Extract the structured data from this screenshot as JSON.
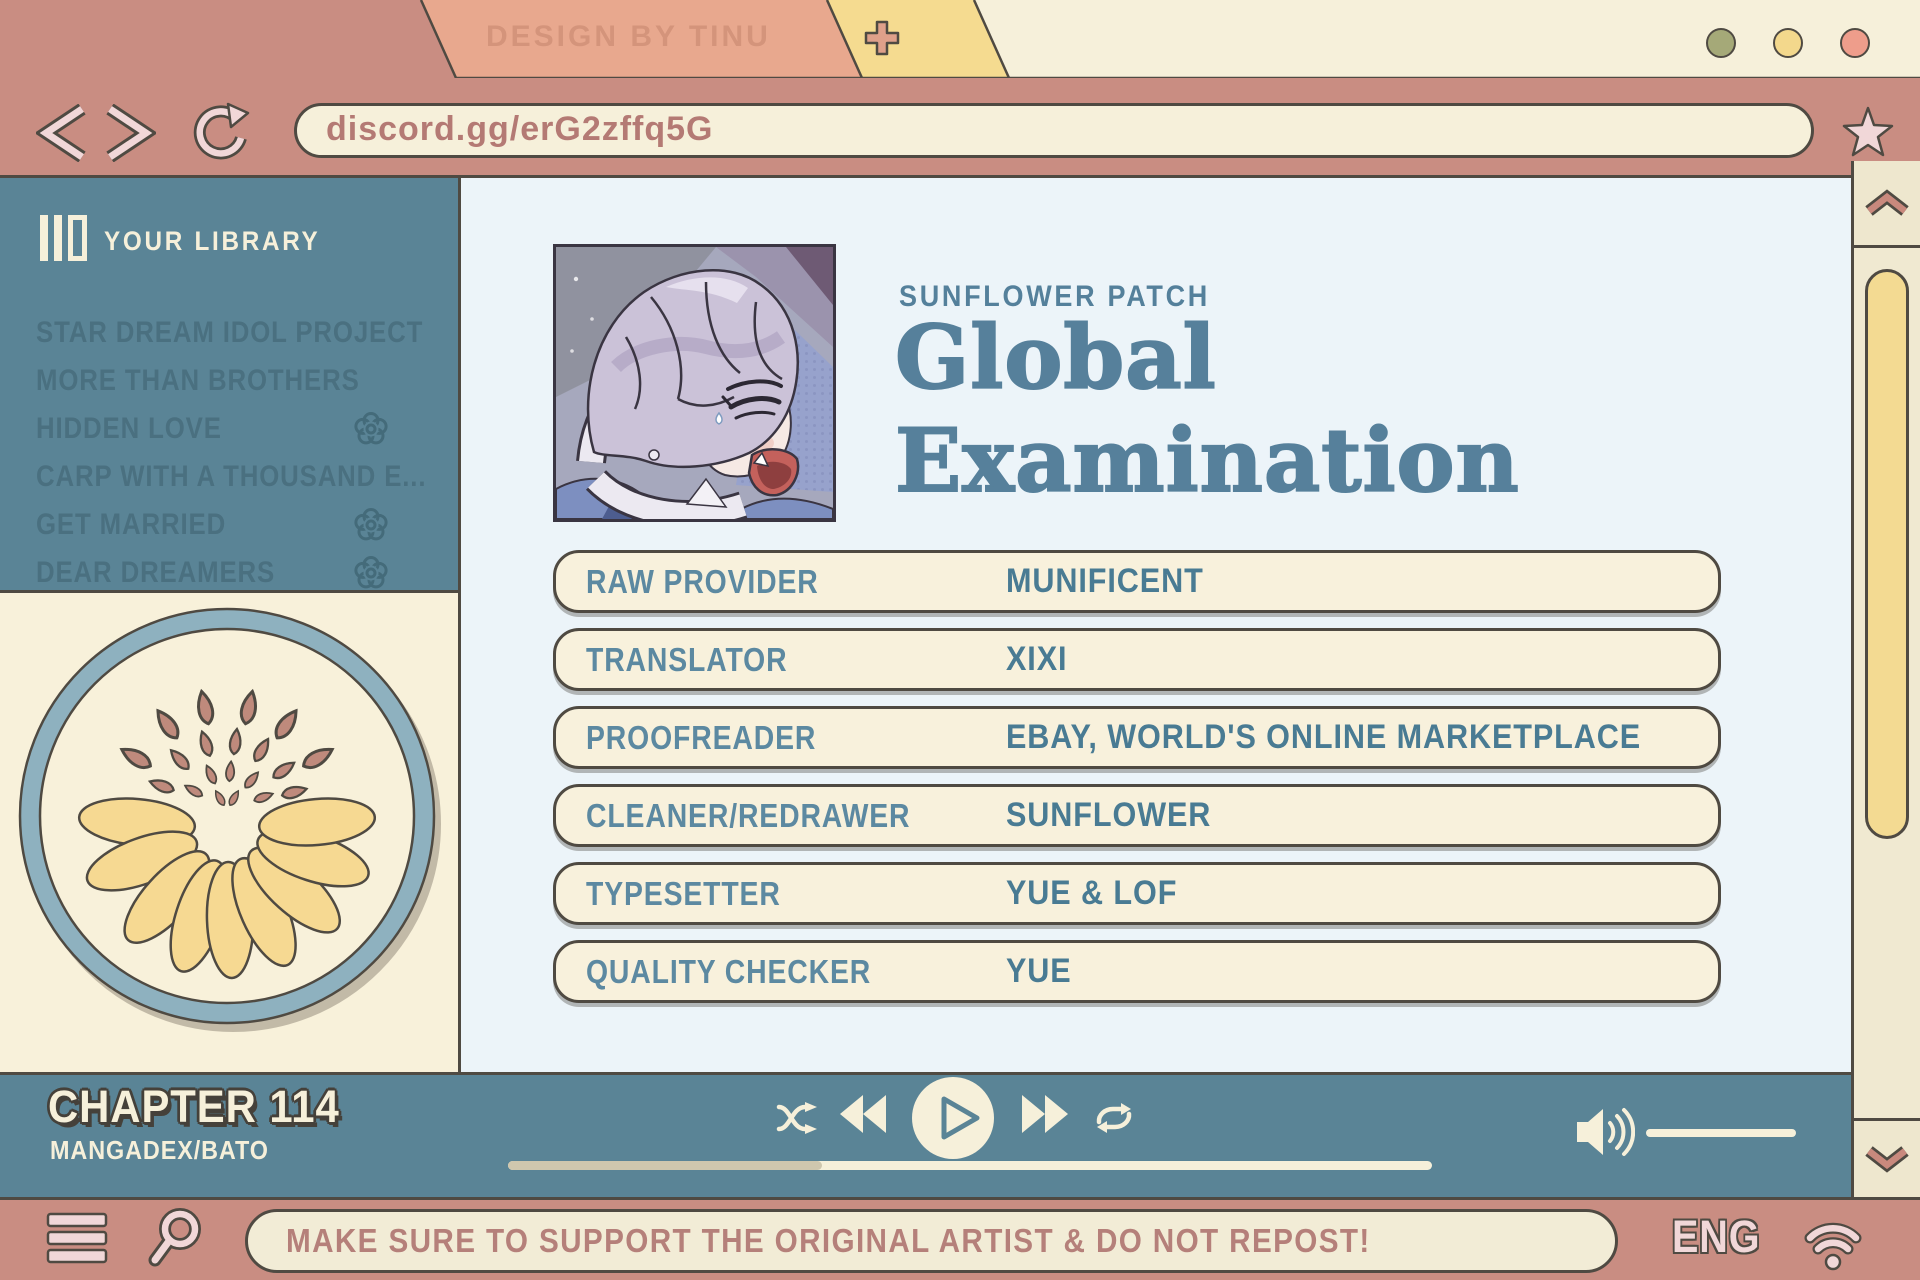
{
  "window": {
    "watermark": "DESIGN BY TINU",
    "controls": [
      {
        "name": "minimize",
        "color": "#a5a978"
      },
      {
        "name": "maximize",
        "color": "#f3d88c"
      },
      {
        "name": "close",
        "color": "#ee9d8b"
      }
    ]
  },
  "browser": {
    "url": "discord.gg/erG2zffq5G"
  },
  "sidebar": {
    "library_title": "YOUR LIBRARY",
    "items": [
      {
        "label": "STAR DREAM IDOL PROJECT"
      },
      {
        "label": "MORE THAN BROTHERS"
      },
      {
        "label": "HIDDEN LOVE"
      },
      {
        "label": "CARP WITH A THOUSAND E..."
      },
      {
        "label": "GET MARRIED"
      },
      {
        "label": "DEAR DREAMERS"
      }
    ]
  },
  "series": {
    "group": "SUNFLOWER PATCH",
    "title": "Global Examination"
  },
  "credits": [
    {
      "role": "RAW PROVIDER",
      "name": "MUNIFICENT"
    },
    {
      "role": "TRANSLATOR",
      "name": "XIXI"
    },
    {
      "role": "PROOFREADER",
      "name": "EBAY, WORLD'S ONLINE MARKETPLACE"
    },
    {
      "role": "CLEANER/REDRAWER",
      "name": "SUNFLOWER"
    },
    {
      "role": "TYPESETTER",
      "name": "YUE & LOF"
    },
    {
      "role": "QUALITY CHECKER",
      "name": "YUE"
    }
  ],
  "player": {
    "chapter": "CHAPTER 114",
    "sources": "MANGADEX/BATO",
    "progress_pct": 34,
    "volume_pct": 100
  },
  "footer": {
    "message": "MAKE SURE TO SUPPORT THE ORIGINAL ARTIST & DO NOT REPOST!",
    "language": "ENG"
  },
  "colors": {
    "pink": "#c98d82",
    "teal": "#5a8496",
    "cream": "#f6f0da",
    "accent_yellow": "#f3da92",
    "title_teal": "#56809b",
    "outline": "#4f4a42"
  }
}
